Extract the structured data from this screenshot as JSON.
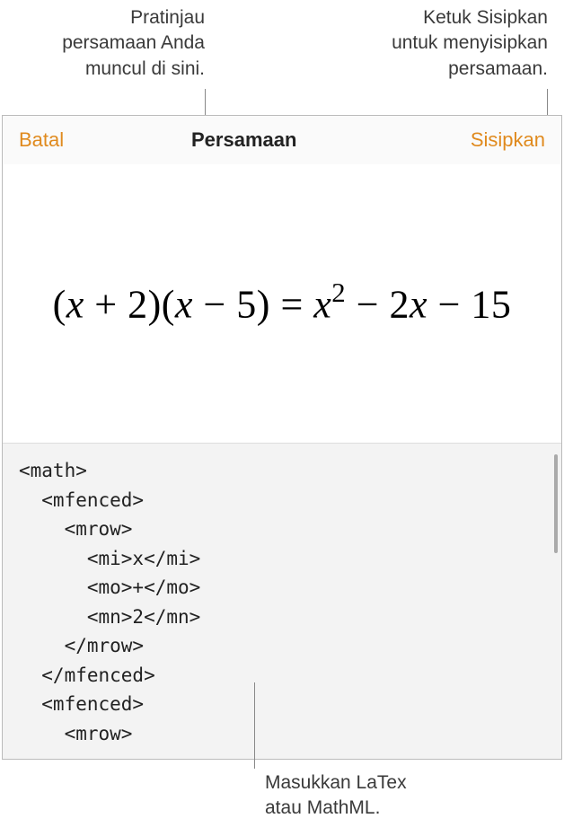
{
  "callouts": {
    "preview": "Pratinjau\npersamaan Anda\nmuncul di sini.",
    "insert": "Ketuk Sisipkan\nuntuk menyisipkan\npersamaan.",
    "input": "Masukkan LaTex\natau MathML."
  },
  "toolbar": {
    "cancel_label": "Batal",
    "title": "Persamaan",
    "insert_label": "Sisipkan"
  },
  "preview": {
    "equation": "(x + 2)(x − 5) = x² − 2x − 15"
  },
  "code": {
    "content": "<math>\n  <mfenced>\n    <mrow>\n      <mi>x</mi>\n      <mo>+</mo>\n      <mn>2</mn>\n    </mrow>\n  </mfenced>\n  <mfenced>\n    <mrow>"
  }
}
